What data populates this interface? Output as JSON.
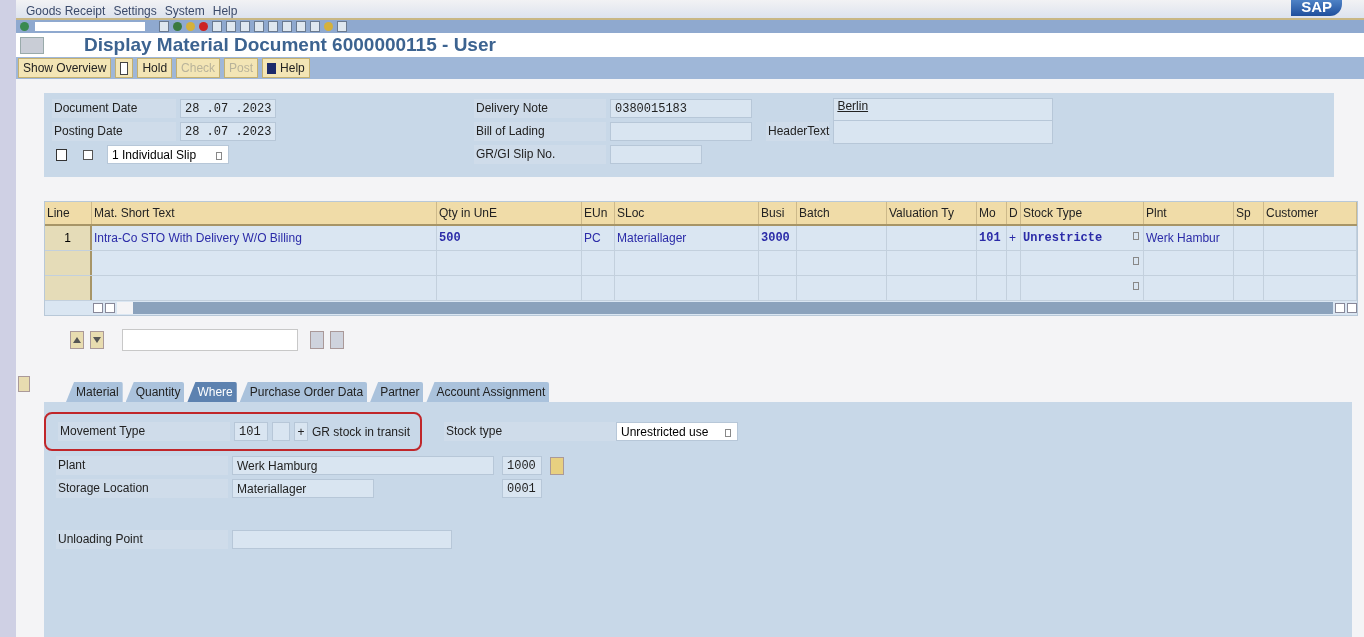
{
  "menu": [
    "Goods Receipt",
    "Settings",
    "System",
    "Help"
  ],
  "logo": {
    "text": "SAP"
  },
  "title": "Display Material Document 6000000115 - User",
  "app_toolbar": [
    {
      "kind": "text",
      "label": "Show Overview",
      "disabled": false
    },
    {
      "kind": "icon"
    },
    {
      "kind": "text",
      "label": "Hold",
      "disabled": false
    },
    {
      "kind": "text",
      "label": "Check",
      "disabled": true
    },
    {
      "kind": "text",
      "label": "Post",
      "disabled": true
    },
    {
      "kind": "info",
      "label": "Help",
      "disabled": false
    }
  ],
  "header": {
    "left": [
      {
        "label": "Document Date",
        "value": "28 .07 .2023"
      },
      {
        "label": "Posting Date",
        "value": "28 .07 .2023"
      }
    ],
    "print_checkbox": {
      "checked": false
    },
    "slip": {
      "value": "1 Individual Slip"
    },
    "middle": [
      {
        "label": "Delivery Note",
        "value": "0380015183"
      },
      {
        "label": "Bill of Lading"
      },
      {
        "label": "GR/GI Slip No."
      }
    ],
    "header_text": {
      "label": "HeaderText",
      "lines": [
        "Berlin"
      ]
    }
  },
  "table": {
    "columns": [
      "Line",
      "Mat. Short Text",
      "Qty in UnE",
      "EUn",
      "SLoc",
      "Busi",
      "Batch",
      "Valuation Ty",
      "Mo",
      "D",
      "Stock Type",
      "Plnt",
      "Sp",
      "Customer"
    ],
    "rows": [
      {
        "selected": false,
        "cells": [
          "1",
          "Intra-Co STO With Delivery W/O Billing",
          "500",
          "PC",
          "Materiallager",
          "3000",
          "",
          "",
          "101",
          "+",
          "Unrestricte",
          "Werk Hambur",
          "",
          ""
        ]
      },
      {
        "selected": false
      },
      {
        "selected": false
      }
    ]
  },
  "tabs": [
    {
      "label": "Material",
      "selected": false
    },
    {
      "label": "Quantity",
      "selected": false
    },
    {
      "label": "Where",
      "selected": true
    },
    {
      "label": "Purchase Order Data",
      "selected": false
    },
    {
      "label": "Partner",
      "selected": false
    },
    {
      "label": "Account Assignment",
      "selected": false
    }
  ],
  "where": {
    "movement": {
      "label": "Movement Type",
      "code": "101",
      "sign": "+",
      "text": "GR stock in transit",
      "highlighted": true
    },
    "stock_type": {
      "label": "Stock type",
      "value": "Unrestricted use"
    },
    "plant": {
      "label": "Plant",
      "value": "Werk Hamburg",
      "code": "1000"
    },
    "storage": {
      "label": "Storage Location",
      "value": "Materiallager",
      "code": "0001"
    },
    "unloading": {
      "label": "Unloading Point"
    }
  }
}
